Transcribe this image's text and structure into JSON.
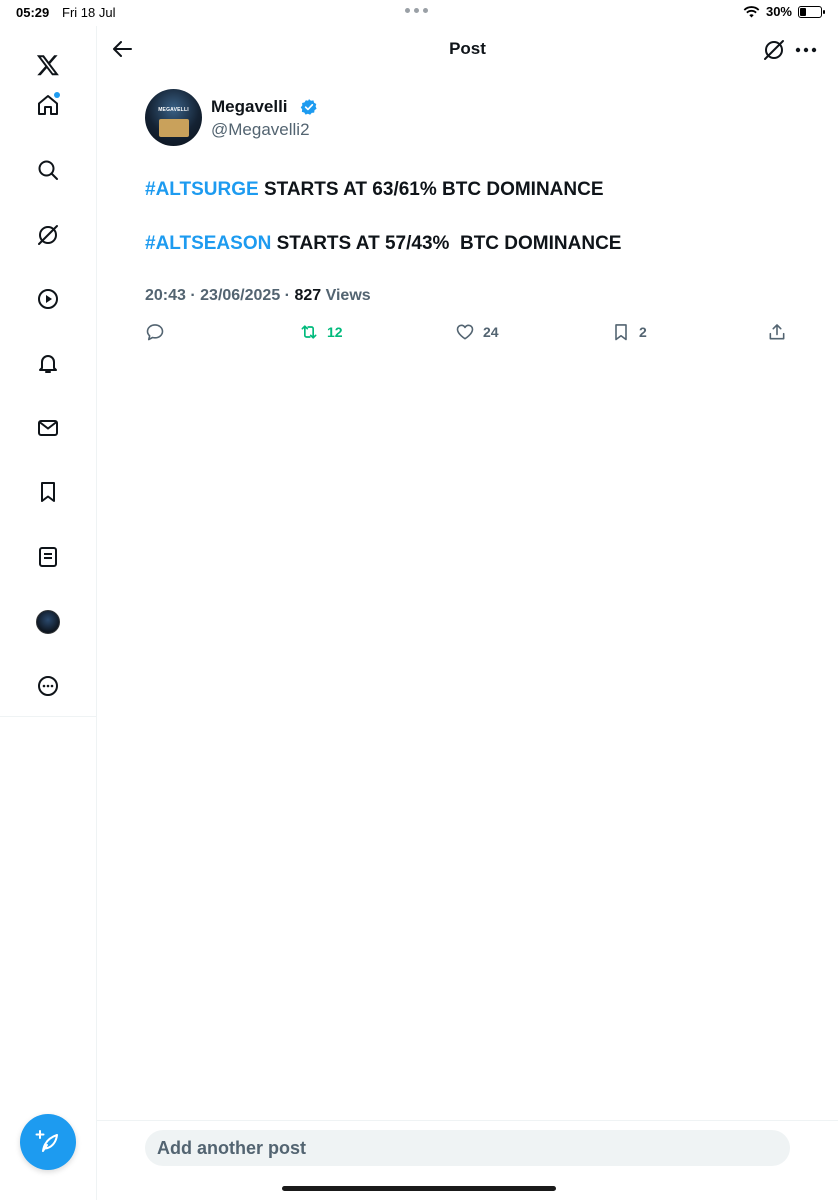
{
  "status_bar": {
    "time": "05:29",
    "date": "Fri 18 Jul",
    "battery_text": "30%",
    "battery_level": 0.3
  },
  "sidebar": {
    "items": [
      {
        "name": "x-logo-icon"
      },
      {
        "name": "home-icon",
        "notification_dot": true
      },
      {
        "name": "search-icon"
      },
      {
        "name": "grok-icon"
      },
      {
        "name": "video-icon"
      },
      {
        "name": "notifications-icon"
      },
      {
        "name": "messages-icon"
      },
      {
        "name": "bookmarks-icon"
      },
      {
        "name": "lists-icon"
      },
      {
        "name": "profile-avatar"
      },
      {
        "name": "more-icon"
      }
    ],
    "compose_icon": "compose-post-icon"
  },
  "header": {
    "title": "Post",
    "back_icon": "arrow-left-icon",
    "grok_icon": "grok-icon",
    "more_icon": "more-horizontal-icon"
  },
  "post": {
    "author_name": "Megavelli",
    "handle": "@Megavelli2",
    "verified": true,
    "lines": [
      {
        "hashtag": "#ALTSURGE",
        "text": " STARTS AT 63/61% BTC DOMINANCE"
      },
      {
        "hashtag": "#ALTSEASON",
        "text": " STARTS AT 57/43%  BTC DOMINANCE"
      }
    ],
    "time": "20:43",
    "date": "23/06/2025",
    "separator": " · ",
    "views_count": "827",
    "views_label": " Views",
    "stats": {
      "reposts": "12",
      "likes": "24",
      "bookmarks": "2"
    }
  },
  "composer": {
    "placeholder": "Add another post"
  },
  "colors": {
    "accent": "#1d9bf0",
    "repost_active": "#00ba7c",
    "secondary_text": "#536471"
  }
}
